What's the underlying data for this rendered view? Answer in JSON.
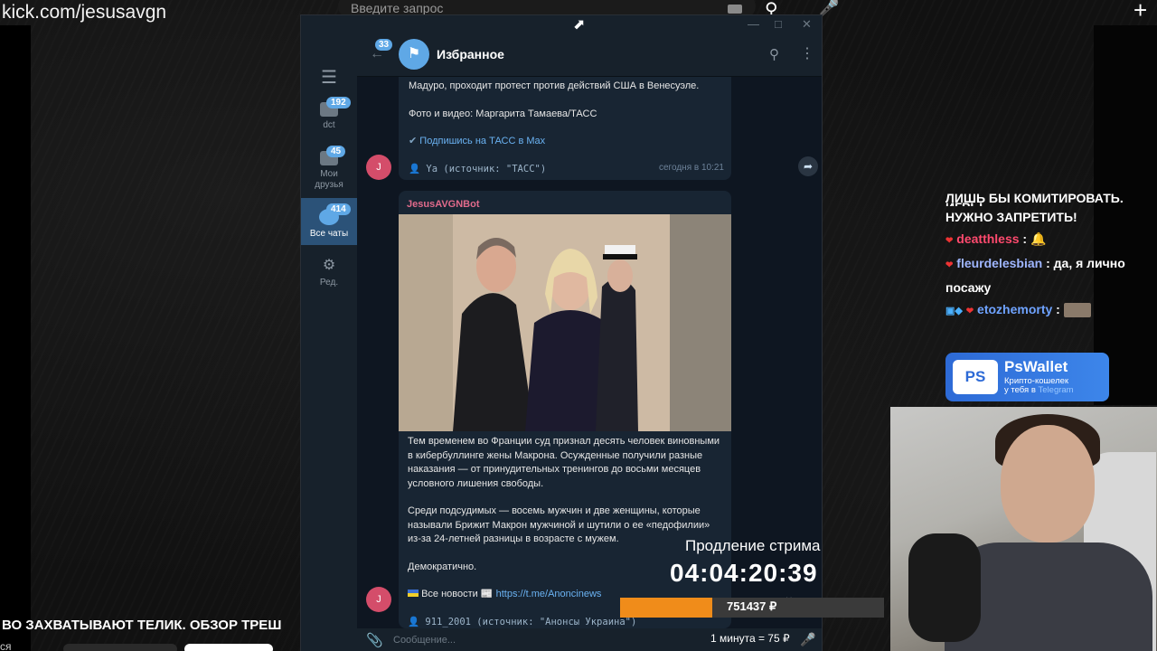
{
  "browser": {
    "url": "kick.com/jesusavgn",
    "search_placeholder": "Введите запрос"
  },
  "telegram": {
    "sidebar": {
      "folders": [
        {
          "label": "dct",
          "badge": "192"
        },
        {
          "label": "Мои друзья",
          "badge": "45"
        },
        {
          "label": "Все чаты",
          "badge": "414"
        },
        {
          "label": "Ред.",
          "badge": ""
        }
      ]
    },
    "header": {
      "back_badge": "33",
      "title": "Избранное"
    },
    "messages": {
      "m1_line1": "Мадуро, проходит протест против действий США в Венесуэле.",
      "m1_line2": "Фото и видео: Маргарита Тамаева/ТАСС",
      "m1_link": "Подпишись на ТАСС в Max",
      "m1_source": "Ya (источник: \"ТАСС\")",
      "m1_time": "сегодня в 10:21",
      "avatar_letter": "J",
      "m2_sender": "JesusAVGNBot",
      "m2_p1": "Тем временем во Франции суд признал десять человек виновными в кибербуллинге жены Макрона. Осужденные получили разные наказания — от принудительных тренингов до восьми месяцев условного лишения свободы.",
      "m2_p2": "Среди подсудимых — восемь мужчин и две женщины, которые называли Брижит Макрон мужчиной и шутили о ее «педофилии» из-за 24-летней разницы в возрасте с мужем.",
      "m2_p3": "Демократично.",
      "m2_news_label": "Все новости",
      "m2_news_link": "https://t.me/Anoncinews",
      "m2_source": "911_2001 (источник: \"Анонсы Украина\")"
    },
    "composer": {
      "placeholder": "Сообщение..."
    }
  },
  "stream_chat": {
    "lines": [
      {
        "user": "",
        "text": "ЛИШЬ БЫ КОМИТИРОВАТЬ. ИГРЫ"
      },
      {
        "user": "",
        "text": "НУЖНО ЗАПРЕТИТЬ!"
      },
      {
        "user": "deatthless",
        "text": ":"
      },
      {
        "user": "fleurdelesbian",
        "text": ": да, я лично посажу"
      },
      {
        "user": "etozhemorty",
        "text": ":"
      }
    ],
    "colors": {
      "deatthless": "#ff4a6e",
      "fleurdelesbian": "#9fb6ff",
      "etozhemorty": "#6fa3ff"
    }
  },
  "ad": {
    "logo": "PS",
    "title": "PsWallet",
    "subtitle_line1": "Крипто-кошелек",
    "subtitle_line2_prefix": "у тебя в",
    "subtitle_line2_highlight": "Telegram"
  },
  "subathon": {
    "label": "Продление стрима",
    "timer": "04:04:20:39",
    "amount": "751437 ₽",
    "progress_fraction": 0.35,
    "rate": "1 минута = 75 ₽",
    "accent": "#f08c1a"
  },
  "stream_title": "ВО ЗАХВАТЫВАЮТ ТЕЛИК. ОБЗОР ТРЕШ",
  "bottom_left_text": "ся"
}
